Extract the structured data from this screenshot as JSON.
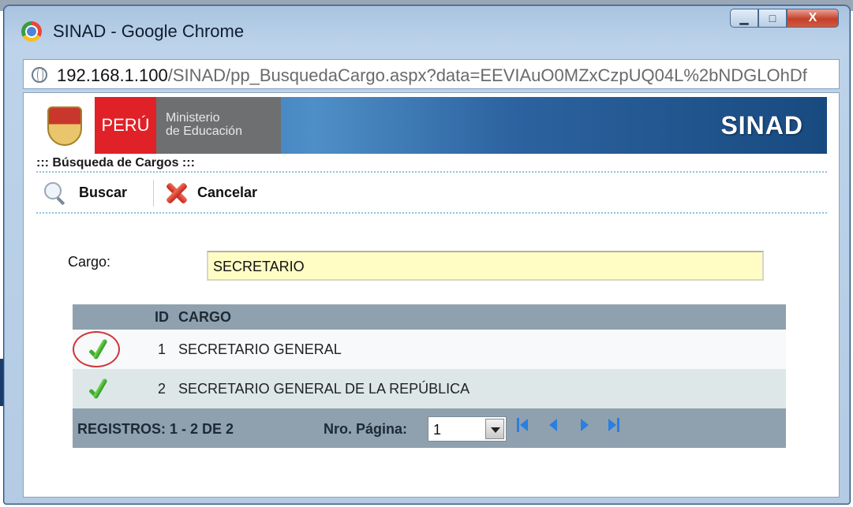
{
  "window": {
    "title": "SINAD - Google Chrome",
    "controls": {
      "minimize": "▁",
      "maximize": "□",
      "close": "X"
    }
  },
  "address": {
    "host": "192.168.1.100",
    "path": "/SINAD/pp_BusquedaCargo.aspx?data=EEVIAuO0MZxCzpUQ04L%2bNDGLOhDf"
  },
  "banner": {
    "peru": "PERÚ",
    "ministerio_line1": "Ministerio",
    "ministerio_line2": "de Educación",
    "sinad": "SINAD"
  },
  "page": {
    "title": "::: Búsqueda de Cargos :::"
  },
  "toolbar": {
    "buscar": "Buscar",
    "cancelar": "Cancelar"
  },
  "form": {
    "cargo_label": "Cargo:",
    "cargo_value": "SECRETARIO"
  },
  "grid": {
    "columns": {
      "id": "ID",
      "cargo": "CARGO"
    },
    "rows": [
      {
        "id": "1",
        "cargo": "SECRETARIO GENERAL",
        "highlighted": true
      },
      {
        "id": "2",
        "cargo": "SECRETARIO GENERAL DE LA REPÚBLICA",
        "highlighted": false
      }
    ],
    "footer": {
      "registros": "REGISTROS: 1 - 2 DE 2",
      "pagina_label": "Nro. Página:",
      "pagina_value": "1"
    }
  },
  "colors": {
    "banner_blue": "#2c63a0",
    "peru_red": "#e02127",
    "grid_header": "#8fa1ae",
    "input_bg": "#fffdc4",
    "highlight_ring": "#d0353a",
    "check_green": "#3cae2a"
  },
  "icons": [
    "chrome-icon",
    "globe-icon",
    "magnify-icon",
    "x-icon",
    "check-icon",
    "first-page-icon",
    "prev-page-icon",
    "next-page-icon",
    "last-page-icon"
  ]
}
